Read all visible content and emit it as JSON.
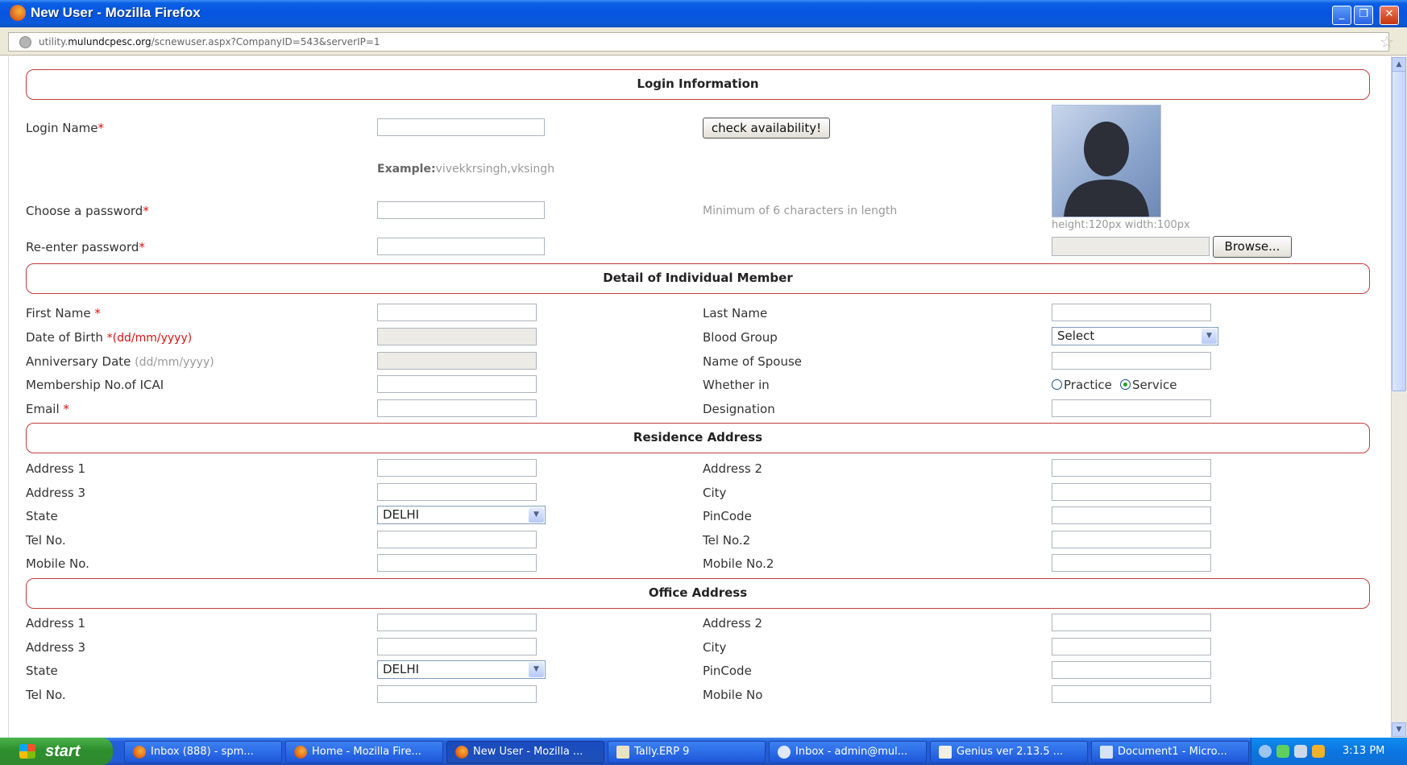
{
  "window": {
    "title": "New User - Mozilla Firefox",
    "min": "_",
    "restore": "❐",
    "close": "✕"
  },
  "urlbar": {
    "prefix": "utility.",
    "domain": "mulundcpesc.org",
    "path": "/scnewuser.aspx?CompanyID=543&serverIP=1"
  },
  "sections": {
    "login": "Login Information",
    "individual": "Detail of Individual Member",
    "residence": "Residence Address",
    "office": "Office Address"
  },
  "login": {
    "login_name": "Login Name",
    "check_button": "check availability!",
    "example_prefix": "Example:",
    "example_value": "vivekkrsingh,vksingh",
    "choose_password": "Choose a password",
    "password_hint": "Minimum of 6 characters in length",
    "reenter_password": "Re-enter password",
    "photo_hint": "height:120px width:100px",
    "browse_button": "Browse..."
  },
  "individual": {
    "first_name": "First Name",
    "last_name": "Last Name",
    "dob": "Date of Birth",
    "dob_format": "*(dd/mm/yyyy)",
    "blood_group": "Blood Group",
    "blood_group_value": "Select",
    "anniversary": "Anniversary Date",
    "anniversary_format": "(dd/mm/yyyy)",
    "spouse": "Name of Spouse",
    "membership": "Membership No.of ICAI",
    "whether_in": "Whether in",
    "practice": "Practice",
    "service": "Service",
    "selected": "Service",
    "email": "Email",
    "designation": "Designation"
  },
  "residence": {
    "address1": "Address 1",
    "address2": "Address 2",
    "address3": "Address 3",
    "city": "City",
    "state": "State",
    "state_value": "DELHI",
    "pincode": "PinCode",
    "tel": "Tel No.",
    "tel2": "Tel No.2",
    "mobile": "Mobile No.",
    "mobile2": "Mobile No.2"
  },
  "office": {
    "address1": "Address 1",
    "address2": "Address 2",
    "address3": "Address 3",
    "city": "City",
    "state": "State",
    "state_value": "DELHI",
    "pincode": "PinCode",
    "tel": "Tel No.",
    "mobile": "Mobile No"
  },
  "taskbar": {
    "start": "start",
    "tasks": [
      "Inbox (888) - spm...",
      "Home - Mozilla Fire...",
      "New User - Mozilla ...",
      "Tally.ERP 9",
      "Inbox - admin@mul...",
      "Genius ver 2.13.5 ...",
      "Document1 - Micro..."
    ],
    "clock": "3:13 PM"
  }
}
